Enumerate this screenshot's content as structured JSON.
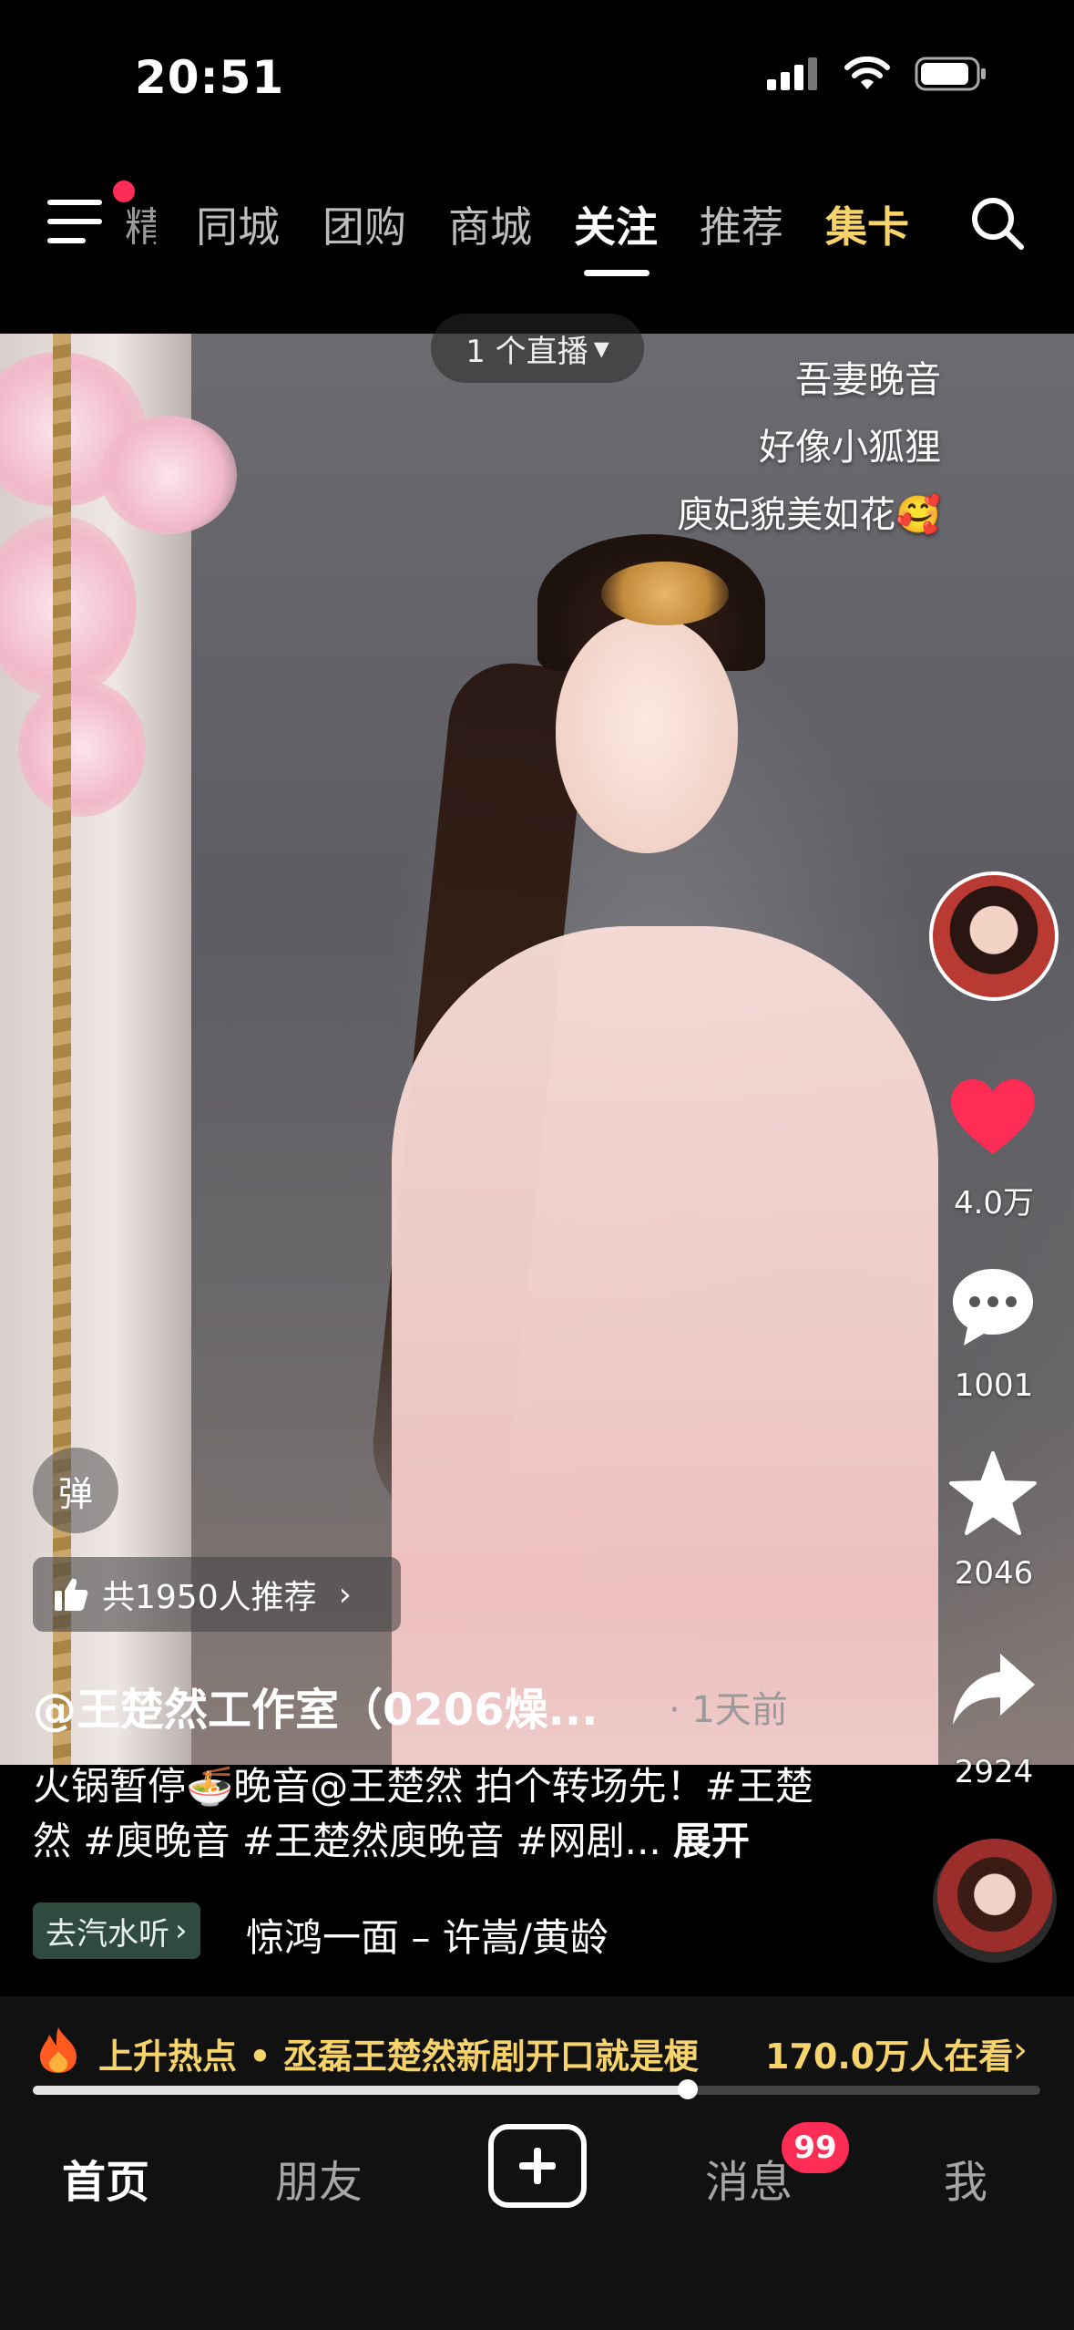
{
  "status_bar": {
    "time": "20:51"
  },
  "top_nav": {
    "cut_tab": "精选",
    "tabs": [
      "同城",
      "团购",
      "商城",
      "关注",
      "推荐",
      "集卡"
    ],
    "active_tab": "关注"
  },
  "video": {
    "live_pill": "1 个直播",
    "lyrics": [
      "吾妻晚音",
      "好像小狐狸",
      "庾妃貌美如花🥰"
    ]
  },
  "right_rail": {
    "likes": "4.0万",
    "comments": "1001",
    "favorites": "2046",
    "shares": "2924"
  },
  "overlay": {
    "danmaku_label": "弹",
    "recommend_text": "共1950人推荐",
    "author": "@王楚然工作室（0206燥...",
    "time_ago": "· 1天前",
    "description": "火锅暂停🍜晚音@王楚然 拍个转场先！#王楚然 #庾晚音 #王楚然庾晚音 #网剧...",
    "expand_label": "展开",
    "soda_label": "去汽水听",
    "music": "惊鸿一面 – 许嵩/黄龄"
  },
  "hot_bar": {
    "text": "上升热点 • 丞磊王楚然新剧开口就是梗",
    "viewers": "170.0万人在看",
    "progress": 0.65
  },
  "tab_bar": {
    "home": "首页",
    "friends": "朋友",
    "messages": "消息",
    "messages_badge": "99",
    "me": "我"
  },
  "colors": {
    "accent_gold": "#f7d36b",
    "like_red": "#ff2d55"
  }
}
